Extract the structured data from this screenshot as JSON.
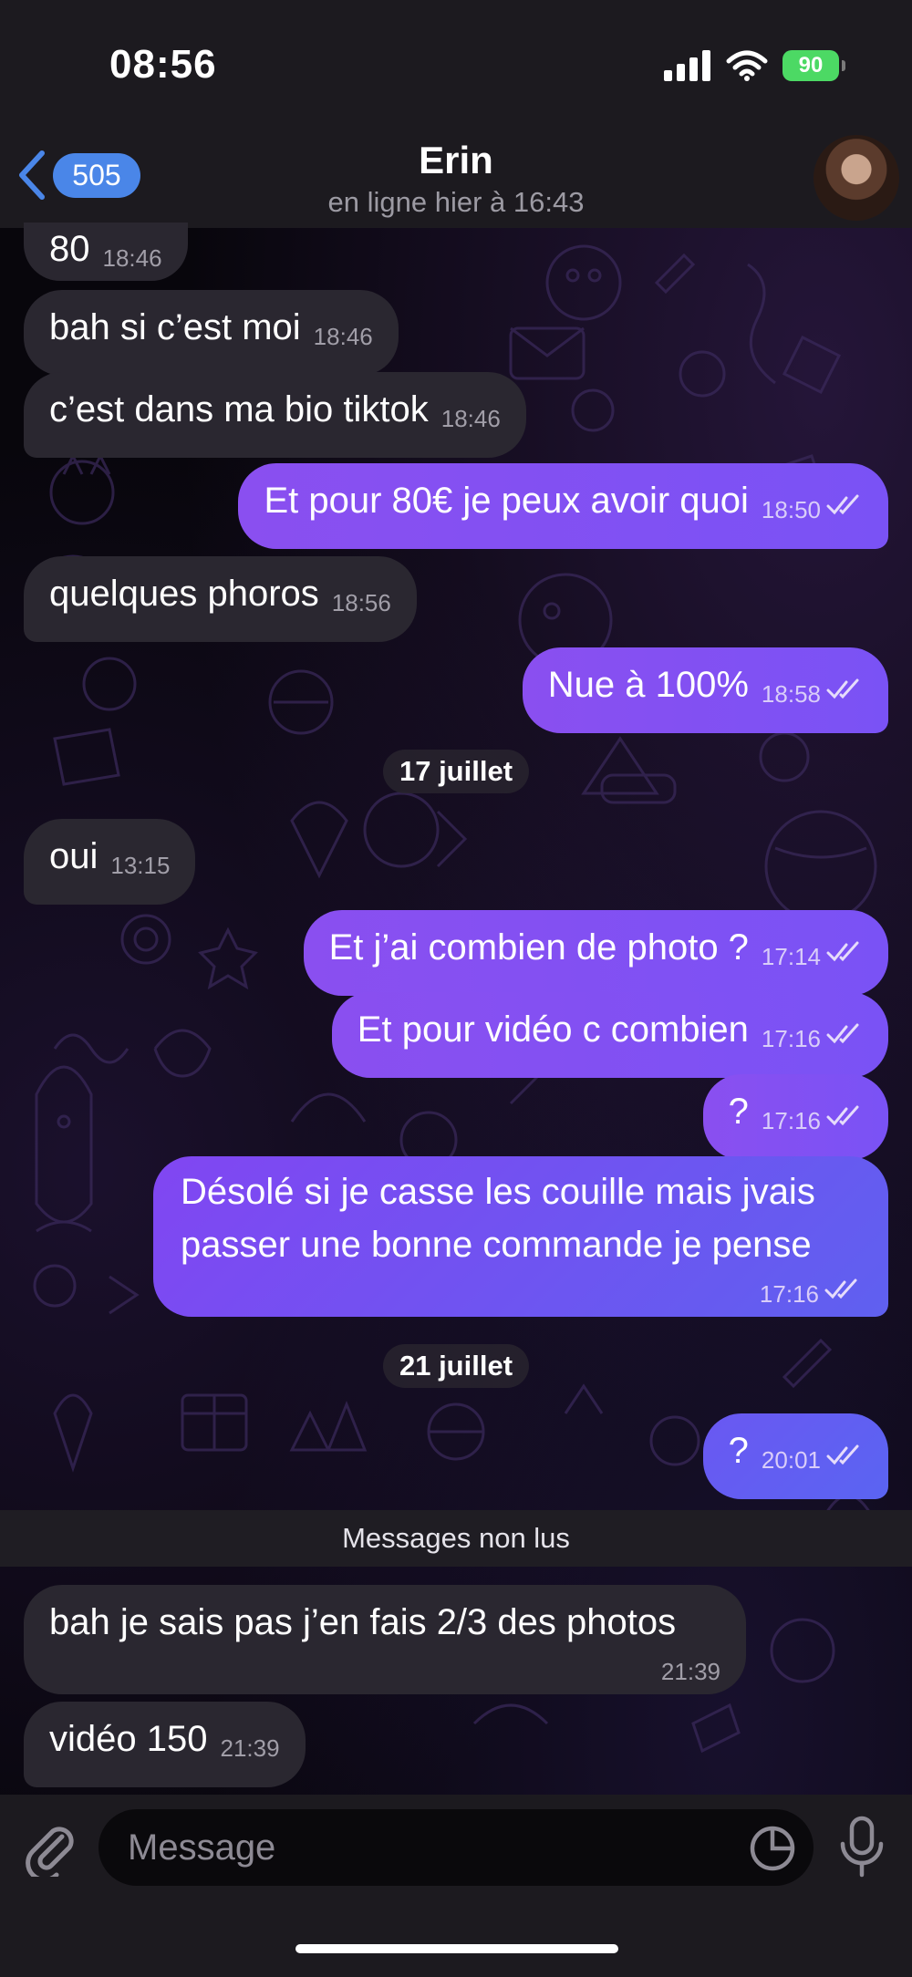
{
  "status_bar": {
    "time": "08:56",
    "battery": "90"
  },
  "header": {
    "back_count": "505",
    "contact_name": "Erin",
    "contact_status": "en ligne hier à 16:43",
    "avatar_icon": "avatar"
  },
  "messages": [
    {
      "dir": "in",
      "text": "80",
      "time": "18:46"
    },
    {
      "dir": "in",
      "text": "bah si c’est moi",
      "time": "18:46"
    },
    {
      "dir": "in",
      "text": "c’est dans ma bio tiktok",
      "time": "18:46"
    },
    {
      "dir": "out",
      "text": "Et pour 80€ je peux avoir quoi",
      "time": "18:50"
    },
    {
      "dir": "in",
      "text": "quelques phoros",
      "time": "18:56"
    },
    {
      "dir": "out",
      "text": "Nue à 100%",
      "time": "18:58"
    },
    {
      "dir": "in",
      "text": "oui",
      "time": "13:15"
    },
    {
      "dir": "out",
      "text": "Et j’ai combien de photo ?",
      "time": "17:14"
    },
    {
      "dir": "out",
      "text": "Et pour vidéo c combien",
      "time": "17:16"
    },
    {
      "dir": "out",
      "text": "?",
      "time": "17:16"
    },
    {
      "dir": "out",
      "text_line1": "Désolé si je casse les couille mais jvais",
      "text_line2": "passer une bonne commande je pense",
      "time": "17:16"
    },
    {
      "dir": "out",
      "text": "?",
      "time": "20:01"
    },
    {
      "dir": "in",
      "text": "bah je sais pas j’en fais 2/3 des photos",
      "time": "21:39"
    },
    {
      "dir": "in",
      "text": "vidéo 150",
      "time": "21:39"
    }
  ],
  "date_separators": [
    "17 juillet",
    "21 juillet"
  ],
  "unread_banner": "Messages non lus",
  "input": {
    "placeholder": "Message"
  },
  "colors": {
    "outgoing_bubble": "#8a4ff0",
    "incoming_bubble": "#2a2730",
    "back_badge": "#4a86e8",
    "battery": "#4cd964"
  }
}
